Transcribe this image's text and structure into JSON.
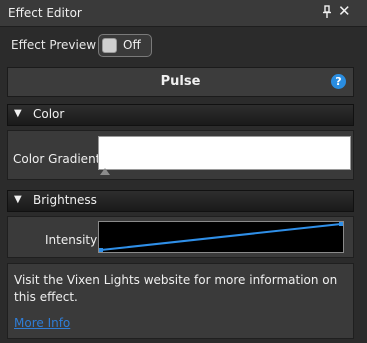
{
  "window": {
    "title": "Effect Editor",
    "pin_icon": "pin-icon",
    "close_icon": "close-icon",
    "close_glyph": "✕"
  },
  "preview": {
    "label": "Effect Preview",
    "toggle_label": "Off"
  },
  "effect": {
    "name": "Pulse",
    "help_glyph": "?"
  },
  "sections": {
    "color": {
      "label": "Color",
      "arrow": "▼"
    },
    "brightness": {
      "label": "Brightness",
      "arrow": "▼"
    }
  },
  "color": {
    "gradient_label": "Color Gradient"
  },
  "brightness": {
    "intensity_label": "Intensity",
    "curve_start_level": 0.0,
    "curve_end_level": 1.0
  },
  "info": {
    "text": "Visit the Vixen Lights website for more information on this effect.",
    "link": "More Info"
  },
  "colors": {
    "accent": "#2a8de0",
    "curve": "#2f8fe8",
    "link": "#2f7dd6"
  }
}
